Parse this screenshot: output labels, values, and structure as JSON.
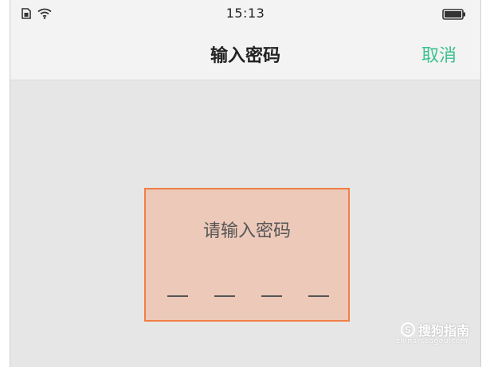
{
  "status_bar": {
    "time": "15:13",
    "icons": [
      "sim-card-icon",
      "wifi-icon",
      "battery-icon"
    ]
  },
  "nav": {
    "title": "输入密码",
    "cancel_label": "取消"
  },
  "dialog": {
    "prompt": "请输入密码",
    "pin_length": 4
  },
  "watermark": {
    "brand_text": "搜狗指南",
    "url": "zhinan.sogou.com",
    "badge": "S"
  },
  "colors": {
    "accent": "#3cc18f",
    "dialog_border": "#f07f45",
    "dialog_fill": "#ecc9b9",
    "background": "#e6e6e6"
  }
}
